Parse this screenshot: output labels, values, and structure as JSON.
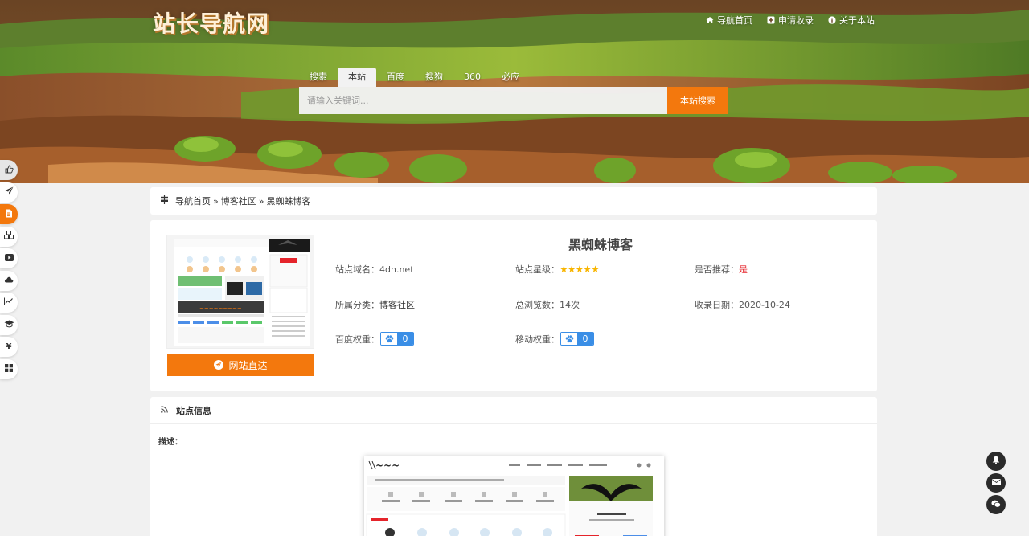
{
  "header": {
    "logo_text": "站长导航网",
    "nav": [
      {
        "label": "导航首页",
        "icon": "home-icon"
      },
      {
        "label": "申请收录",
        "icon": "plus-square-icon"
      },
      {
        "label": "关于本站",
        "icon": "info-circle-icon"
      }
    ]
  },
  "search": {
    "tabs": [
      "搜索",
      "本站",
      "百度",
      "搜狗",
      "360",
      "必应"
    ],
    "active_tab": "本站",
    "placeholder": "请输入关键词...",
    "button_label": "本站搜索"
  },
  "sidebar": {
    "icons": [
      "thumbs-up-icon",
      "paper-plane-icon",
      "document-icon",
      "cubes-icon",
      "video-icon",
      "cloud-icon",
      "line-chart-icon",
      "graduation-cap-icon",
      "yen-icon",
      "grid-icon"
    ],
    "active": "document-icon"
  },
  "right_float": {
    "icons": [
      "bell-icon",
      "mail-icon",
      "wechat-icon"
    ]
  },
  "breadcrumb": {
    "items": [
      "导航首页",
      "博客社区",
      "黑蜘蛛博客"
    ],
    "separator": "»"
  },
  "site": {
    "name": "黑蜘蛛博客",
    "visit_label": "网站直达",
    "domain_label": "站点域名：",
    "domain": "4dn.net",
    "rating_label": "站点星级：",
    "rating": 5,
    "recommend_label": "是否推荐：",
    "recommend": "是",
    "category_label": "所属分类：",
    "category": "博客社区",
    "views_label": "总浏览数：",
    "views": "14次",
    "date_label": "收录日期：",
    "date": "2020-10-24",
    "baidu_weight_label": "百度权重：",
    "baidu_weight": "0",
    "mobile_weight_label": "移动权重：",
    "mobile_weight": "0"
  },
  "info": {
    "title": "站点信息",
    "desc_label": "描述："
  },
  "colors": {
    "accent": "#f3780d",
    "weight_blue": "#3a8ee6",
    "star": "#f8b500",
    "recommend_red": "#e5242b"
  }
}
